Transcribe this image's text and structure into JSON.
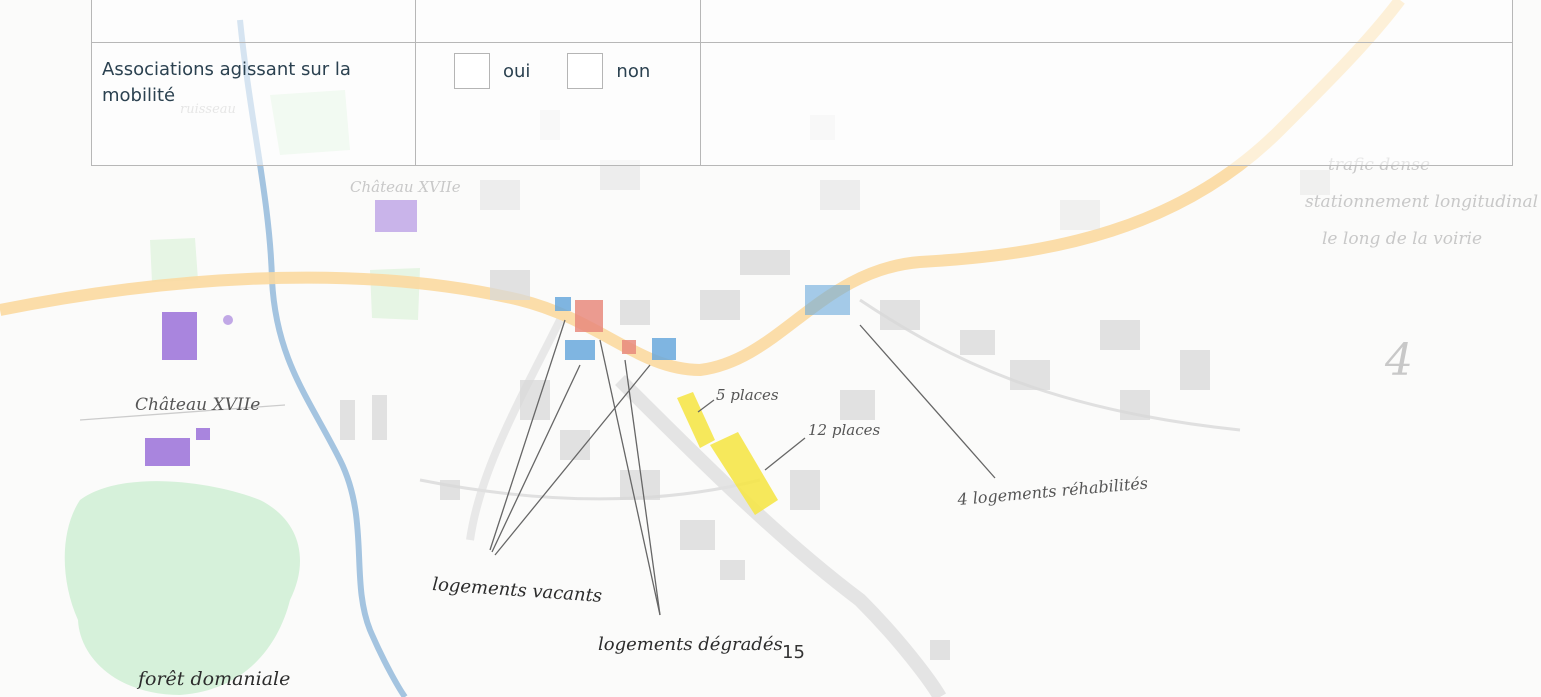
{
  "table": {
    "rows": [
      {
        "label": "",
        "options": [],
        "notes": ""
      },
      {
        "label": "Associations agissant sur la mobilité",
        "options": [
          "oui",
          "non"
        ],
        "notes": ""
      }
    ]
  },
  "map_labels": {
    "chateau_top": "Château XVIIe",
    "chateau_left": "Château XVIIe",
    "ruisseau": "ruisseau",
    "places_5": "5 places",
    "places_12": "12 places",
    "logements_rehabilites": "4 logements réhabilités",
    "logements_vacants": "logements vacants",
    "logements_degrades": "logements dégradés",
    "foret": "forêt domaniale",
    "trafic_line1": "trafic dense",
    "trafic_line2": "stationnement longitudinal",
    "trafic_line3": "le long de la voirie"
  },
  "page_number": "15",
  "colors": {
    "text": "#2b4150",
    "border": "#b7b7b7",
    "road": "#fbd9a0",
    "parking": "#f6e64a",
    "vacant": "#69a9dc",
    "degraded": "#e88a7d",
    "chateau": "#9a6fd8",
    "forest": "#bfe8c4"
  }
}
